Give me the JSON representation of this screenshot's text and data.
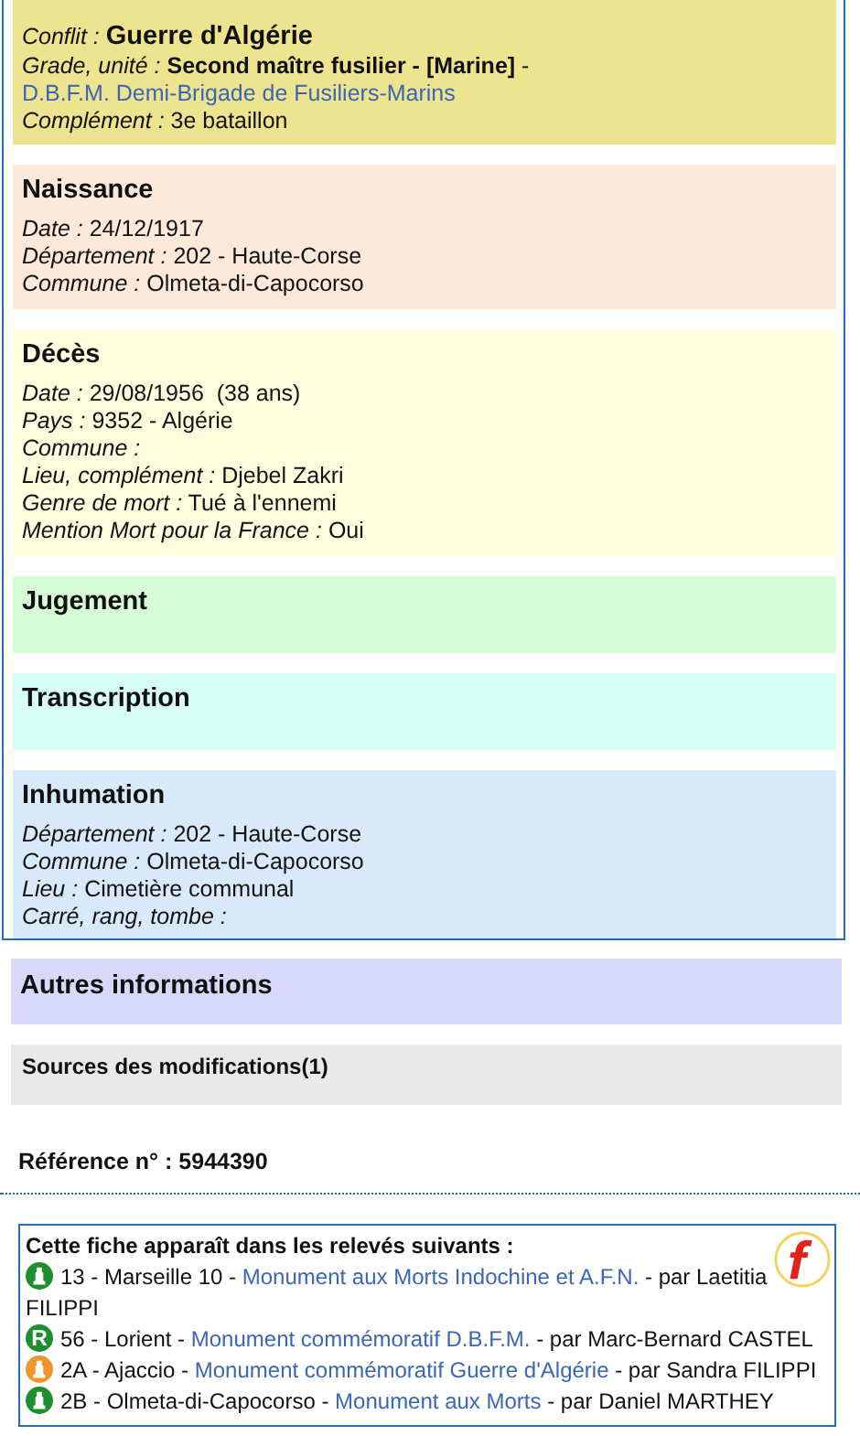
{
  "record_sections": [
    {
      "kind": "conflict",
      "color": "#eee48f",
      "fields": [
        {
          "label": "Conflit :",
          "value": "Guerre d'Algérie",
          "large": true
        },
        {
          "label": "Grade, unité :",
          "value": "**Second maître fusilier - [Marine]** - ",
          "large": false,
          "link": "D.B.F.M. Demi-Brigade de Fusiliers-Marins"
        },
        {
          "label": "Complément :",
          "value": "3e bataillon",
          "large": false
        }
      ]
    },
    {
      "kind": "section",
      "title": "Naissance",
      "color": "#fde9d9",
      "fields": [
        {
          "label": "Date :",
          "value": "24/12/1917",
          "large": false
        },
        {
          "label": "Département :",
          "value": "202 - Haute-Corse",
          "large": false
        },
        {
          "label": "Commune :",
          "value": "Olmeta-di-Capocorso",
          "large": false
        }
      ]
    },
    {
      "kind": "section",
      "title": "Décès",
      "color": "#ffffdf",
      "fields": [
        {
          "label": "Date :",
          "value": "29/08/1956  (38 ans)",
          "large": false
        },
        {
          "label": "Pays :",
          "value": "9352 - Algérie",
          "large": false
        },
        {
          "label": "Commune :",
          "large": false
        },
        {
          "label": "Lieu, complément :",
          "value": "Djebel Zakri",
          "large": false
        },
        {
          "label": "Genre de mort :",
          "value": "Tué à l'ennemi",
          "large": false
        },
        {
          "label": "Mention Mort pour la France :",
          "value": "Oui",
          "large": false
        }
      ]
    },
    {
      "kind": "section",
      "title": "Jugement",
      "color": "#d7fdd7"
    },
    {
      "kind": "section",
      "title": "Transcription",
      "color": "#d7fef4"
    },
    {
      "kind": "section",
      "title": "Inhumation",
      "color": "#d8e9f9",
      "fields": [
        {
          "label": "Département :",
          "value": "202 - Haute-Corse",
          "large": false
        },
        {
          "label": "Commune :",
          "value": "Olmeta-di-Capocorso",
          "large": false
        },
        {
          "label": "Lieu :",
          "value": "Cimetière communal",
          "large": false
        },
        {
          "label": "Carré, rang, tombe :",
          "large": false
        }
      ]
    }
  ],
  "other_info": {
    "title": "Autres informations"
  },
  "sources": {
    "title": "Sources des modifications(1)"
  },
  "reference": "Référence n° : 5944390",
  "listings": {
    "title": "Cette fiche apparaît dans les relevés suivants :",
    "items": [
      {
        "kind": "monument",
        "color": "#1e8e2e",
        "place": "13 - Marseille 10 - ",
        "link": "Monument aux Morts Indochine et A.F.N.",
        "author": " - par Laetitia FILIPPI"
      },
      {
        "kind": "letter",
        "letter": "R",
        "color": "#1e8e2e",
        "place": "56 - Lorient - ",
        "link": "Monument commémoratif D.B.F.M.",
        "author": " - par Marc-Bernard CASTEL"
      },
      {
        "kind": "monument",
        "color": "#f0952a",
        "place": "2A - Ajaccio - ",
        "link": "Monument commémoratif Guerre d'Algérie",
        "author": " - par Sandra FILIPPI"
      },
      {
        "kind": "monument",
        "color": "#1e8e2e",
        "place": "2B - Olmeta-di-Capocorso - ",
        "link": "Monument aux Morts",
        "author": " - par Daniel MARTHEY"
      }
    ]
  }
}
